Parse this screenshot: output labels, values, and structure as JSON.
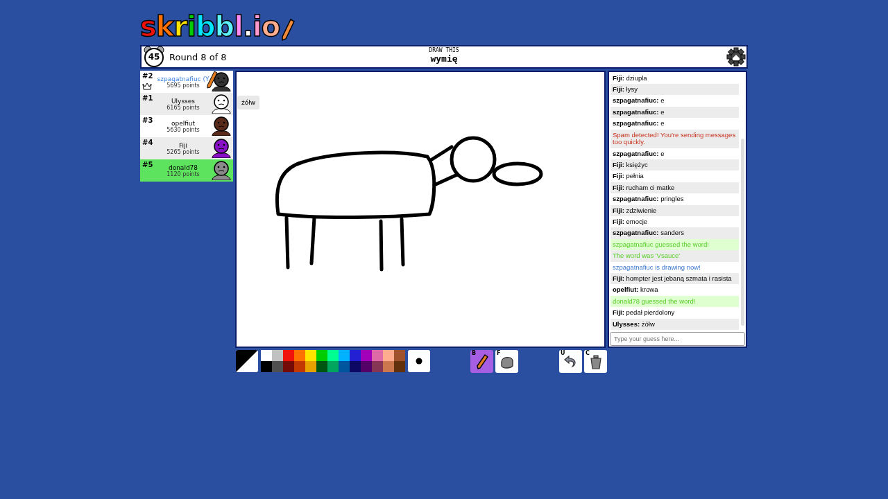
{
  "logo": {
    "text": "skribbl.io"
  },
  "header": {
    "timer": "45",
    "round": "Round 8 of 8",
    "hint_label": "DRAW THIS",
    "word": "wymię"
  },
  "players": [
    {
      "rank": "#2",
      "name": "szpagatnafiuc (Y",
      "points": "5695 points",
      "you": true,
      "owner": true,
      "drawing": true,
      "guessed": false,
      "color": "#333333"
    },
    {
      "rank": "#1",
      "name": "Ulysses",
      "points": "6165 points",
      "you": false,
      "owner": false,
      "drawing": false,
      "guessed": false,
      "color": "#ffffff",
      "bubble": "żółw"
    },
    {
      "rank": "#3",
      "name": "opelfiut",
      "points": "5630 points",
      "you": false,
      "owner": false,
      "drawing": false,
      "guessed": false,
      "color": "#5a2a1a"
    },
    {
      "rank": "#4",
      "name": "Fiji",
      "points": "5265 points",
      "you": false,
      "owner": false,
      "drawing": false,
      "guessed": false,
      "color": "#8a10c8"
    },
    {
      "rank": "#5",
      "name": "donald78",
      "points": "1120 points",
      "you": false,
      "owner": false,
      "drawing": false,
      "guessed": true,
      "color": "#8a8a8a"
    }
  ],
  "chat": {
    "messages": [
      {
        "kind": "chat",
        "author": "Fiji:",
        "text": "dziupla"
      },
      {
        "kind": "chat",
        "author": "Fiji:",
        "text": "łysy"
      },
      {
        "kind": "chat",
        "author": "szpagatnafiuc:",
        "text": "e"
      },
      {
        "kind": "chat",
        "author": "szpagatnafiuc:",
        "text": "e"
      },
      {
        "kind": "chat",
        "author": "szpagatnafiuc:",
        "text": "e"
      },
      {
        "kind": "spam",
        "text": "Spam detected! You're sending messages too quickly."
      },
      {
        "kind": "chat",
        "author": "szpagatnafiuc:",
        "text": "e"
      },
      {
        "kind": "chat",
        "author": "Fiji:",
        "text": "księżyc"
      },
      {
        "kind": "chat",
        "author": "Fiji:",
        "text": "pełnia"
      },
      {
        "kind": "chat",
        "author": "Fiji:",
        "text": "rucham ci matke"
      },
      {
        "kind": "chat",
        "author": "szpagatnafiuc:",
        "text": "pringles"
      },
      {
        "kind": "chat",
        "author": "Fiji:",
        "text": "zdziwienie"
      },
      {
        "kind": "chat",
        "author": "Fiji:",
        "text": "emocje"
      },
      {
        "kind": "chat",
        "author": "szpagatnafiuc:",
        "text": "sanders"
      },
      {
        "kind": "guessed",
        "text": "szpagatnafiuc guessed the word!"
      },
      {
        "kind": "reveal",
        "text": "The word was 'Vsauce'"
      },
      {
        "kind": "drawing",
        "text": "szpagatnafiuc is drawing now!"
      },
      {
        "kind": "chat",
        "author": "Fiji:",
        "text": "hompter jest jebaną szmata i rasista"
      },
      {
        "kind": "chat",
        "author": "opelfiut:",
        "text": "krowa"
      },
      {
        "kind": "guessed",
        "text": "donald78 guessed the word!"
      },
      {
        "kind": "chat",
        "author": "Fiji:",
        "text": "pedał pierdolony"
      },
      {
        "kind": "chat",
        "author": "Ulysses:",
        "text": "żółw"
      }
    ],
    "input": {
      "placeholder": "Type your guess here..."
    }
  },
  "palette": [
    {
      "color": "#ffffff"
    },
    {
      "color": "#c1c1c1"
    },
    {
      "color": "#ef130b"
    },
    {
      "color": "#ff7100"
    },
    {
      "color": "#ffe400"
    },
    {
      "color": "#00cc00"
    },
    {
      "color": "#00ff91"
    },
    {
      "color": "#00b2ff"
    },
    {
      "color": "#231fd3"
    },
    {
      "color": "#a300ba"
    },
    {
      "color": "#df69a7"
    },
    {
      "color": "#ffac8e"
    },
    {
      "color": "#a0522d"
    },
    {
      "color": "#000000"
    },
    {
      "color": "#505050"
    },
    {
      "color": "#740b07"
    },
    {
      "color": "#c23800"
    },
    {
      "color": "#e8a200"
    },
    {
      "color": "#005510"
    },
    {
      "color": "#00a65d"
    },
    {
      "color": "#00569e"
    },
    {
      "color": "#0e0865"
    },
    {
      "color": "#550069"
    },
    {
      "color": "#873554"
    },
    {
      "color": "#cc774d"
    },
    {
      "color": "#63300d"
    }
  ],
  "tools": [
    {
      "kind": "pencil",
      "key": "B",
      "selected": true
    },
    {
      "kind": "fill",
      "key": "F",
      "selected": false
    }
  ],
  "actions": [
    {
      "kind": "undo",
      "key": "U"
    },
    {
      "kind": "clear",
      "key": "C"
    }
  ]
}
